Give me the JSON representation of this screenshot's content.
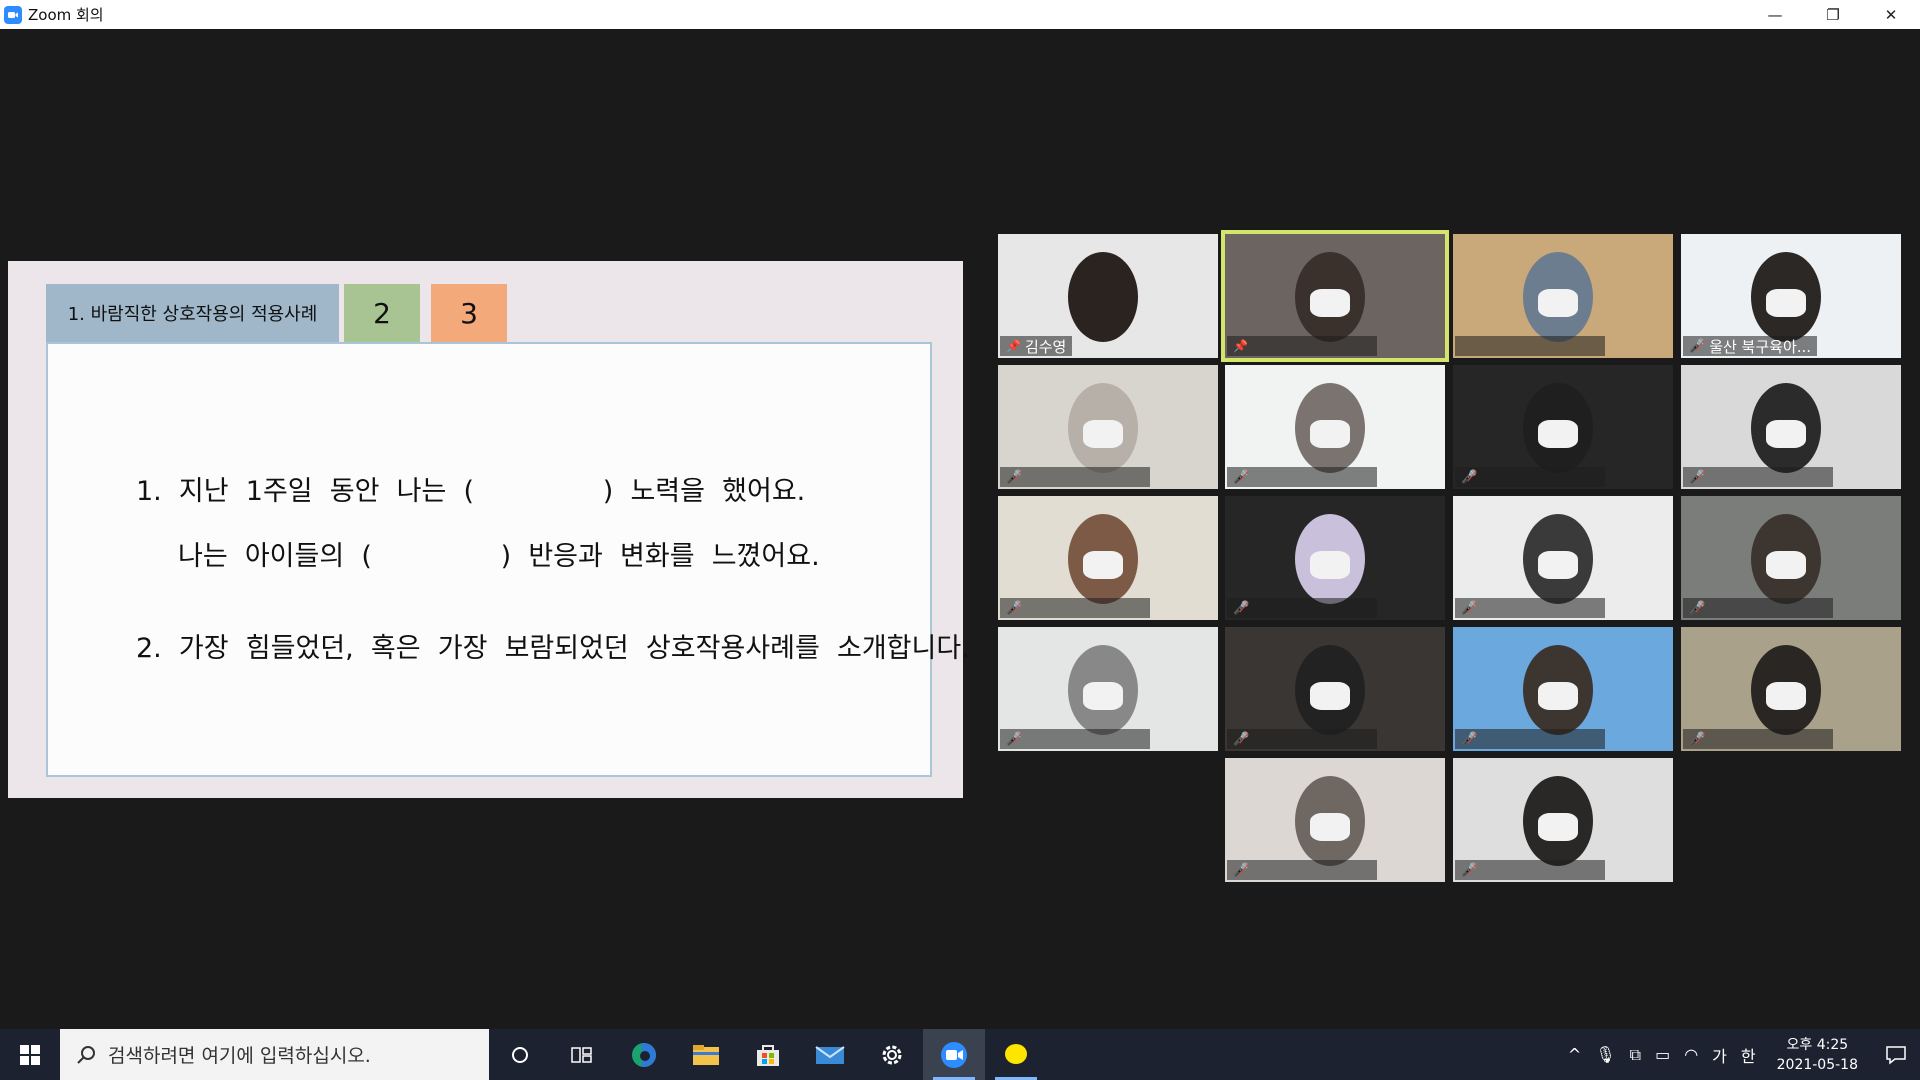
{
  "window": {
    "title": "Zoom 회의",
    "minimize": "—",
    "restore": "❐",
    "close": "✕"
  },
  "slide": {
    "tabs": [
      "1. 바람직한 상호작용의 적용사례",
      "2",
      "3"
    ],
    "lines": [
      "1.  지난  1주일  동안  나는  (               )  노력을  했어요.",
      "나는  아이들의  (               )  반응과  변화를  느꼈어요.",
      "2.  가장  힘들었던,  혹은  가장  보람되었던  상호작용사례를  소개합니다."
    ]
  },
  "participants": [
    {
      "name": "김수영",
      "pinned": true,
      "muted": false
    },
    {
      "name": "",
      "pinned": true,
      "muted": false,
      "active_speaker": true
    },
    {
      "name": "",
      "muted": false
    },
    {
      "name": "울산 북구육아...",
      "muted": true
    },
    {
      "name": "",
      "muted": true
    },
    {
      "name": "",
      "muted": true
    },
    {
      "name": "",
      "muted": true
    },
    {
      "name": "",
      "muted": true
    },
    {
      "name": "",
      "muted": true
    },
    {
      "name": "",
      "muted": true
    },
    {
      "name": "",
      "muted": true
    },
    {
      "name": "",
      "muted": true
    },
    {
      "name": "",
      "muted": true
    },
    {
      "name": "",
      "muted": true
    },
    {
      "name": "",
      "muted": true
    },
    {
      "name": "",
      "muted": true
    },
    {
      "name": "",
      "muted": true
    },
    {
      "name": "",
      "muted": true
    }
  ],
  "taskbar": {
    "search_placeholder": "검색하려면 여기에 입력하십시오.",
    "apps": [
      "cortana-icon",
      "task-view-icon",
      "edge-icon",
      "file-explorer-icon",
      "store-icon",
      "mail-icon",
      "settings-icon",
      "zoom-icon",
      "kakaotalk-icon"
    ],
    "tray": {
      "ime_lang": "가",
      "ime_mode": "한",
      "time": "오후 4:25",
      "date": "2021-05-18"
    }
  },
  "colors": {
    "zoom_blue": "#2d8cff",
    "active_speaker": "#d5e46b",
    "tab1": "#9fb7c8",
    "tab2": "#a9c493",
    "tab3": "#f3a97a"
  }
}
